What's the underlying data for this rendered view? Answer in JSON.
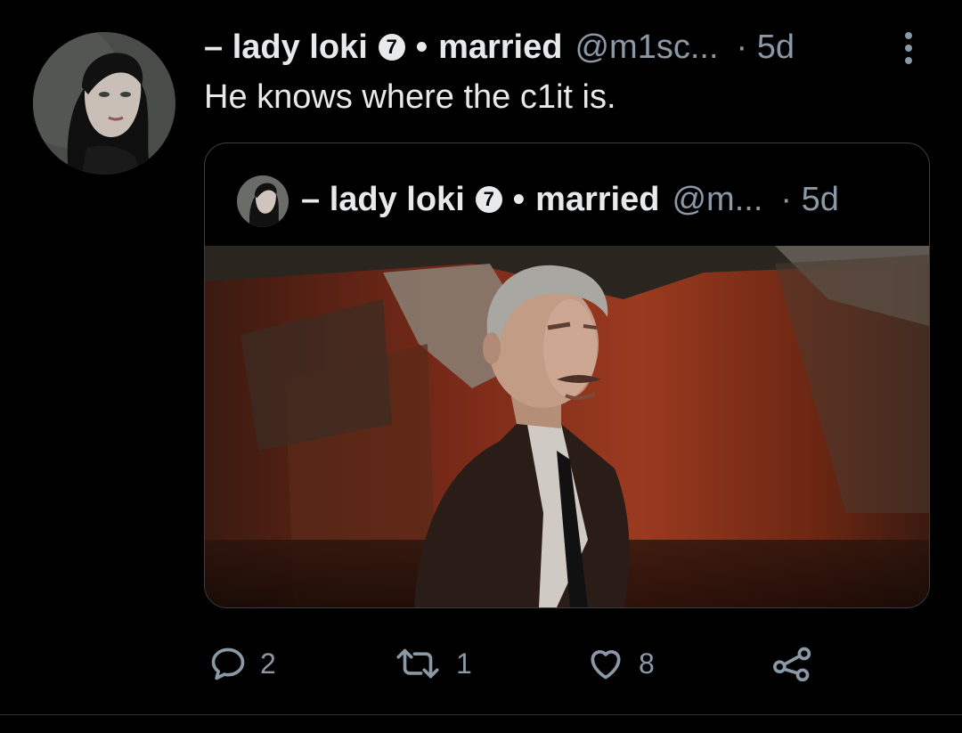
{
  "tweet": {
    "display_name": "– lady loki",
    "badge": "7",
    "separator": "•",
    "name_tail": "married",
    "handle": "@m1sc...",
    "time": "· 5d",
    "text": "He knows where the c1it is."
  },
  "quote": {
    "display_name": "– lady loki",
    "badge": "7",
    "separator": "•",
    "name_tail": "married",
    "handle": "@m...",
    "time": "· 5d"
  },
  "actions": {
    "reply_count": "2",
    "retweet_count": "1",
    "like_count": "8"
  },
  "icons": {
    "more": "more-vertical-icon",
    "reply": "reply-icon",
    "retweet": "retweet-icon",
    "like": "heart-icon",
    "share": "share-icon"
  },
  "colors": {
    "background": "#000000",
    "text": "#e7e9ea",
    "muted": "#8b98a5",
    "border": "#3a3f44"
  }
}
